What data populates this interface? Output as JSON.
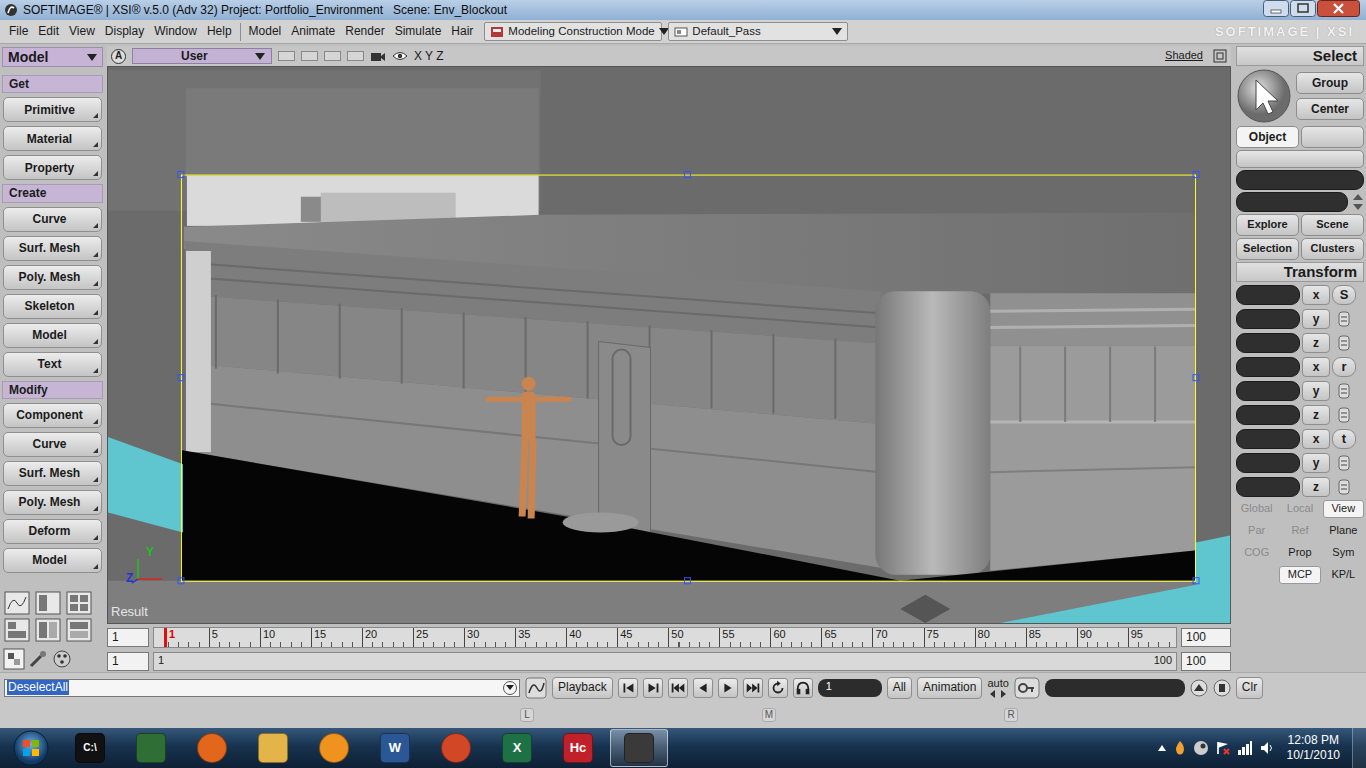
{
  "window": {
    "title": "SOFTIMAGE® | XSI® v.5.0 (Adv 32) Project: Portfolio_Environment   Scene: Env_Blockout"
  },
  "menu": {
    "items": [
      "File",
      "Edit",
      "View",
      "Display",
      "Window",
      "Help"
    ],
    "modules": [
      "Model",
      "Animate",
      "Render",
      "Simulate",
      "Hair"
    ],
    "mode": "Modeling Construction Mode",
    "pass": "Default_Pass",
    "brand": "SOFTIMAGE | XSI"
  },
  "toolbar": {
    "module": "Model",
    "sections": [
      {
        "title": "Get",
        "buttons": [
          "Primitive",
          "Material",
          "Property"
        ]
      },
      {
        "title": "Create",
        "buttons": [
          "Curve",
          "Surf. Mesh",
          "Poly. Mesh",
          "Skeleton",
          "Model",
          "Text"
        ]
      },
      {
        "title": "Modify",
        "buttons": [
          "Component",
          "Curve",
          "Surf. Mesh",
          "Poly. Mesh",
          "Deform",
          "Model"
        ]
      }
    ]
  },
  "viewport": {
    "badge": "A",
    "camera": "User",
    "axes": "X Y Z",
    "display": "Shaded",
    "label": "Result",
    "gizmo": [
      "Y",
      "Z"
    ]
  },
  "select_panel": {
    "title": "Select",
    "buttons": [
      {
        "label": "Group",
        "selected": false
      },
      {
        "label": "Center",
        "selected": false
      },
      {
        "label": "Object",
        "selected": true
      }
    ],
    "nav": [
      "Explore",
      "Scene",
      "Selection",
      "Clusters"
    ]
  },
  "transform_panel": {
    "title": "Transform",
    "groups": [
      {
        "tool": "S",
        "axes": [
          "x",
          "y",
          "z"
        ]
      },
      {
        "tool": "r",
        "axes": [
          "x",
          "y",
          "z"
        ]
      },
      {
        "tool": "t",
        "axes": [
          "x",
          "y",
          "z"
        ]
      }
    ],
    "modes": [
      [
        {
          "label": "Global",
          "selected": false,
          "disabled": true
        },
        {
          "label": "Local",
          "selected": false,
          "disabled": true
        },
        {
          "label": "View",
          "selected": true,
          "disabled": false
        }
      ],
      [
        {
          "label": "Par",
          "selected": false,
          "disabled": true
        },
        {
          "label": "Ref",
          "selected": false,
          "disabled": true
        },
        {
          "label": "Plane",
          "selected": false,
          "disabled": false
        }
      ],
      [
        {
          "label": "COG",
          "selected": false,
          "disabled": true
        },
        {
          "label": "Prop",
          "selected": false,
          "disabled": false
        },
        {
          "label": "Sym",
          "selected": false,
          "disabled": false
        }
      ],
      [
        {
          "label": "MCP",
          "selected": true,
          "disabled": false
        },
        {
          "label": "KP/L",
          "selected": false,
          "disabled": false
        }
      ]
    ]
  },
  "timeline": {
    "start": "1",
    "playhead": "1",
    "ticks": [
      "5",
      "10",
      "15",
      "20",
      "25",
      "30",
      "35",
      "40",
      "45",
      "50",
      "55",
      "60",
      "65",
      "70",
      "75",
      "80",
      "85",
      "90",
      "95"
    ],
    "end": "100",
    "range_start": "1",
    "slider_start": "1",
    "slider_end": "100",
    "range_end": "100"
  },
  "playback": {
    "command": "DeselectAll",
    "button": "Playback",
    "frame": "1",
    "all": "All",
    "animation": "Animation",
    "auto": "auto",
    "clear": "Clr"
  },
  "mouse_line": [
    "L",
    "M",
    "R"
  ],
  "taskbar": {
    "apps": [
      {
        "glyph": "C:\\",
        "color": "#111111",
        "active": false
      },
      {
        "glyph": "",
        "color": "#2f6e35",
        "active": false
      },
      {
        "glyph": "",
        "color": "#e2661c",
        "active": false
      },
      {
        "glyph": "",
        "color": "#e3b448",
        "active": false
      },
      {
        "glyph": "",
        "color": "#f0931e",
        "active": false
      },
      {
        "glyph": "W",
        "color": "#2b5797",
        "active": false
      },
      {
        "glyph": "",
        "color": "#d24726",
        "active": false
      },
      {
        "glyph": "X",
        "color": "#1e7145",
        "active": false
      },
      {
        "glyph": "Hc",
        "color": "#c0202a",
        "active": false
      },
      {
        "glyph": "",
        "color": "#3a3a3a",
        "active": true
      }
    ],
    "time": "12:08 PM",
    "date": "10/1/2010"
  }
}
